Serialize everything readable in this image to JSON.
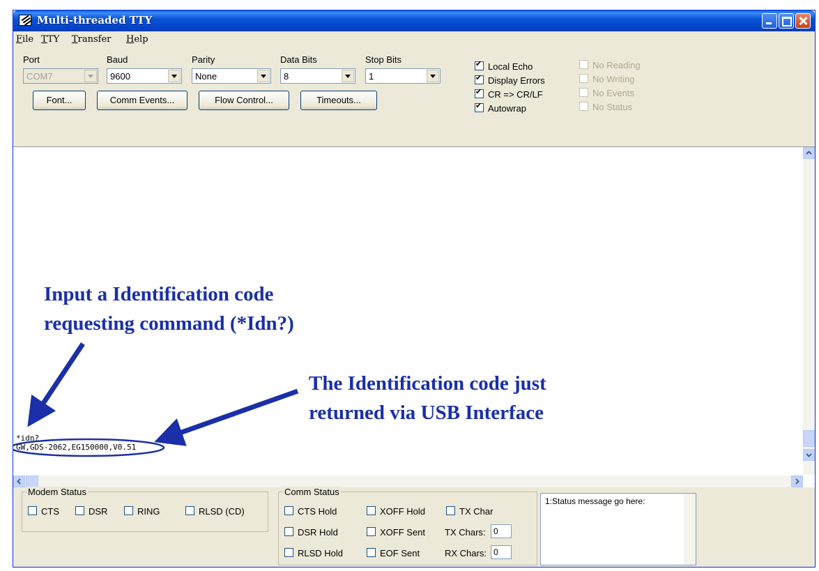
{
  "window": {
    "title": "Multi-threaded TTY"
  },
  "menu": {
    "items": [
      {
        "label": "File",
        "underline": "F",
        "rest": "ile"
      },
      {
        "label": "TTY",
        "underline": "T",
        "rest": "TY"
      },
      {
        "label": "Transfer",
        "underline": "T",
        "rest": "ransfer"
      },
      {
        "label": "Help",
        "underline": "H",
        "rest": "elp"
      }
    ]
  },
  "settings": {
    "port": {
      "label": "Port",
      "value": "COM7"
    },
    "baud": {
      "label": "Baud",
      "value": "9600"
    },
    "parity": {
      "label": "Parity",
      "value": "None"
    },
    "data_bits": {
      "label": "Data Bits",
      "value": "8"
    },
    "stop_bits": {
      "label": "Stop Bits",
      "value": "1"
    }
  },
  "buttons": {
    "font": "Font...",
    "comm_events": "Comm Events...",
    "flow_control": "Flow Control...",
    "timeouts": "Timeouts..."
  },
  "options": [
    {
      "label": "Local Echo",
      "checked": true,
      "enabled": true
    },
    {
      "label": "Display Errors",
      "checked": true,
      "enabled": true
    },
    {
      "label": "CR => CR/LF",
      "checked": true,
      "enabled": true
    },
    {
      "label": "Autowrap",
      "checked": true,
      "enabled": true
    },
    {
      "label": "No Reading",
      "checked": false,
      "enabled": false
    },
    {
      "label": "No Writing",
      "checked": false,
      "enabled": false
    },
    {
      "label": "No Events",
      "checked": false,
      "enabled": false
    },
    {
      "label": "No Status",
      "checked": false,
      "enabled": false
    }
  ],
  "terminal": {
    "lines": [
      "*idn?",
      "GW,GDS-2062,EG150000,V0.51"
    ]
  },
  "annotations": {
    "input_line1": "Input a Identification code",
    "input_line2": "requesting command (*Idn?)",
    "output_line1": "The Identification code just",
    "output_line2": "returned via USB Interface",
    "color": "#1a2fa8"
  },
  "modem_status": {
    "title": "Modem Status",
    "items": [
      "CTS",
      "DSR",
      "RING",
      "RLSD (CD)"
    ]
  },
  "comm_status": {
    "title": "Comm Status",
    "cts_hold": "CTS Hold",
    "xoff_hold": "XOFF Hold",
    "tx_char": "TX Char",
    "dsr_hold": "DSR Hold",
    "xoff_sent": "XOFF Sent",
    "tx_chars_label": "TX Chars:",
    "tx_chars_value": "0",
    "rlsd_hold": "RLSD Hold",
    "eof_sent": "EOF Sent",
    "rx_chars_label": "RX Chars:",
    "rx_chars_value": "0"
  },
  "status_message": "1:Status message go here:"
}
